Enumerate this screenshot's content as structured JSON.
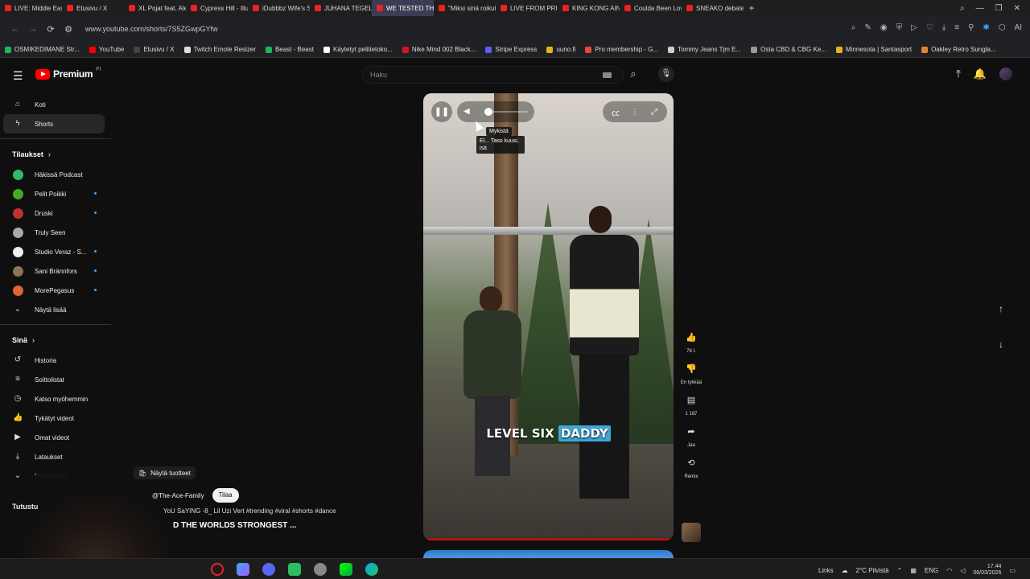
{
  "tabs": [
    {
      "label": "LIVE: Middle East m",
      "active": false
    },
    {
      "label": "Etusivu / X",
      "active": false
    },
    {
      "label": "XL Pojat feat. Aleks",
      "active": false
    },
    {
      "label": "Cypress Hill - Illusio",
      "active": false
    },
    {
      "label": "iDubbbz Wife's Stre",
      "active": false
    },
    {
      "label": "JUHANA TEGELBER",
      "active": false
    },
    {
      "label": "WE TESTED THE WOR",
      "active": true
    },
    {
      "label": "\"Miksi sinä roikut s",
      "active": false
    },
    {
      "label": "LIVE FROM PRISON",
      "active": false
    },
    {
      "label": "KING KONG AINT G",
      "active": false
    },
    {
      "label": "Coulda Been Love 2",
      "active": false
    },
    {
      "label": "SNEAKO debates Isr",
      "active": false
    }
  ],
  "address": {
    "url": "www.youtube.com/shorts/7S5ZGwpGYfw"
  },
  "bookmarks": [
    {
      "label": "OSMIKEDIMANE Str...",
      "color": "#1db954"
    },
    {
      "label": "YouTube",
      "color": "#ff0000"
    },
    {
      "label": "Etusivu / X",
      "color": "#444444"
    },
    {
      "label": "Twitch Emote Resizer",
      "color": "#dddddd"
    },
    {
      "label": "Beast - Beast",
      "color": "#1db954"
    },
    {
      "label": "Käytetyt pelitietoko...",
      "color": "#ffffff"
    },
    {
      "label": "Nike Mind 002 Black...",
      "color": "#d12"
    },
    {
      "label": "Stripe Express",
      "color": "#635bff"
    },
    {
      "label": "uuno.fi",
      "color": "#e8b31a"
    },
    {
      "label": "Pro membership - G...",
      "color": "#e44"
    },
    {
      "label": "Tommy Jeans Tjm E...",
      "color": "#ccc"
    },
    {
      "label": "Osta CBD & CBG Ke...",
      "color": "#999"
    },
    {
      "label": "Minnesota | Santasport",
      "color": "#e8b31a"
    },
    {
      "label": "Oakley Retro Sungla...",
      "color": "#d83"
    }
  ],
  "header": {
    "logo": "Premium",
    "logo_sup": "FI",
    "search_placeholder": "Haku"
  },
  "sidebar": {
    "main": [
      {
        "label": "Koti",
        "icon": "home-icon"
      },
      {
        "label": "Shorts",
        "icon": "shorts-icon",
        "active": true
      }
    ],
    "subs_heading": "Tilaukset",
    "subs": [
      {
        "label": "Häkissä Podcast",
        "color": "#3b6"
      },
      {
        "label": "Pelit Poikki",
        "color": "#4a2"
      },
      {
        "label": "Druski",
        "color": "#b33"
      },
      {
        "label": "Truly Seen",
        "color": "#aaa"
      },
      {
        "label": "Studio Veraz - S...",
        "color": "#eee"
      },
      {
        "label": "Sani Brännfors",
        "color": "#875"
      },
      {
        "label": "MorePegasus",
        "color": "#d63"
      }
    ],
    "show_more": "Näytä lisää",
    "you_heading": "Sinä",
    "you": [
      {
        "label": "Historia",
        "icon": "history-icon"
      },
      {
        "label": "Soittolistat",
        "icon": "playlists-icon"
      },
      {
        "label": "Katso myöhemmin",
        "icon": "watch-later-icon"
      },
      {
        "label": "Tykätyt videot",
        "icon": "liked-icon"
      },
      {
        "label": "Omat videot",
        "icon": "my-videos-icon"
      },
      {
        "label": "Lataukset",
        "icon": "downloads-icon"
      },
      {
        "label": "Näytä lisää",
        "icon": "chevron-down-icon"
      }
    ],
    "explore": "Tutustu"
  },
  "player": {
    "tooltip": "Mykistä",
    "tooltip2": "El... Taso kuusi, isä",
    "caption_white": "LEVEL SIX",
    "caption_hl": "DADDY"
  },
  "actions": {
    "likes": "76 t.",
    "dislike": "En tykkää",
    "comments": "1 187",
    "share": "Jaa",
    "remix": "Remix"
  },
  "video_meta": {
    "shop": "Näytä tuotteet",
    "channel": "@The-Ace-Family",
    "subscribe": "Tilaa",
    "description": "YoU SaYING -8_ Lil Uzi Vert #trending #viral #shorts #dance",
    "title": "D THE WORLDS STRONGEST ..."
  },
  "taskbar": {
    "links": "Links",
    "weather": "2°C  Pilvistä",
    "lang": "ENG",
    "time": "17.44",
    "date": "06/03/2026"
  }
}
